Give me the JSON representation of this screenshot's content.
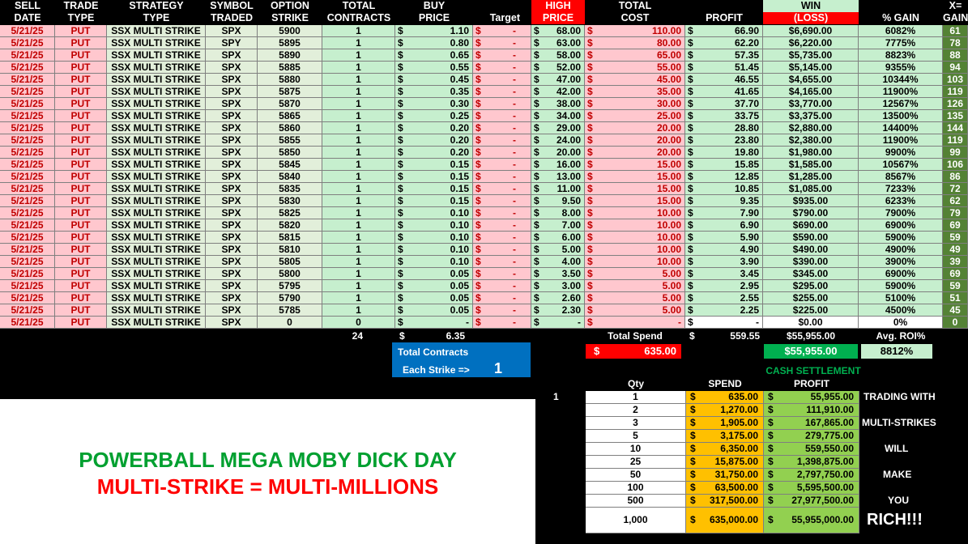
{
  "headers": {
    "sell_date": [
      "SELL",
      "DATE"
    ],
    "trade_type": [
      "TRADE",
      "TYPE"
    ],
    "strategy": [
      "STRATEGY",
      "TYPE"
    ],
    "symbol": [
      "SYMBOL",
      "TRADED"
    ],
    "option": [
      "OPTION",
      "STRIKE"
    ],
    "total_contracts": [
      "TOTAL",
      "CONTRACTS"
    ],
    "buy": [
      "BUY",
      "PRICE"
    ],
    "target": "Target",
    "high": [
      "HIGH",
      "PRICE"
    ],
    "total_cost": [
      "TOTAL",
      "COST"
    ],
    "profit": "PROFIT",
    "win": "WIN",
    "loss": "(LOSS)",
    "pct_gain": "% GAIN",
    "x_gain": [
      "X=",
      "GAIN"
    ]
  },
  "rows": [
    [
      "5/21/25",
      "PUT",
      "SSX MULTI STRIKE",
      "SPX",
      "5900",
      "1",
      "1.10",
      "-",
      "68.00",
      "110.00",
      "66.90",
      "$6,690.00",
      "6082%",
      "61"
    ],
    [
      "5/21/25",
      "PUT",
      "SSX MULTI STRIKE",
      "SPY",
      "5895",
      "1",
      "0.80",
      "-",
      "63.00",
      "80.00",
      "62.20",
      "$6,220.00",
      "7775%",
      "78"
    ],
    [
      "5/21/25",
      "PUT",
      "SSX MULTI STRIKE",
      "SPX",
      "5890",
      "1",
      "0.65",
      "-",
      "58.00",
      "65.00",
      "57.35",
      "$5,735.00",
      "8823%",
      "88"
    ],
    [
      "5/21/25",
      "PUT",
      "SSX MULTI STRIKE",
      "SPX",
      "5885",
      "1",
      "0.55",
      "-",
      "52.00",
      "55.00",
      "51.45",
      "$5,145.00",
      "9355%",
      "94"
    ],
    [
      "5/21/25",
      "PUT",
      "SSX MULTI STRIKE",
      "SPX",
      "5880",
      "1",
      "0.45",
      "-",
      "47.00",
      "45.00",
      "46.55",
      "$4,655.00",
      "10344%",
      "103"
    ],
    [
      "5/21/25",
      "PUT",
      "SSX MULTI STRIKE",
      "SPX",
      "5875",
      "1",
      "0.35",
      "-",
      "42.00",
      "35.00",
      "41.65",
      "$4,165.00",
      "11900%",
      "119"
    ],
    [
      "5/21/25",
      "PUT",
      "SSX MULTI STRIKE",
      "SPX",
      "5870",
      "1",
      "0.30",
      "-",
      "38.00",
      "30.00",
      "37.70",
      "$3,770.00",
      "12567%",
      "126"
    ],
    [
      "5/21/25",
      "PUT",
      "SSX MULTI STRIKE",
      "SPX",
      "5865",
      "1",
      "0.25",
      "-",
      "34.00",
      "25.00",
      "33.75",
      "$3,375.00",
      "13500%",
      "135"
    ],
    [
      "5/21/25",
      "PUT",
      "SSX MULTI STRIKE",
      "SPX",
      "5860",
      "1",
      "0.20",
      "-",
      "29.00",
      "20.00",
      "28.80",
      "$2,880.00",
      "14400%",
      "144"
    ],
    [
      "5/21/25",
      "PUT",
      "SSX MULTI STRIKE",
      "SPX",
      "5855",
      "1",
      "0.20",
      "-",
      "24.00",
      "20.00",
      "23.80",
      "$2,380.00",
      "11900%",
      "119"
    ],
    [
      "5/21/25",
      "PUT",
      "SSX MULTI STRIKE",
      "SPX",
      "5850",
      "1",
      "0.20",
      "-",
      "20.00",
      "20.00",
      "19.80",
      "$1,980.00",
      "9900%",
      "99"
    ],
    [
      "5/21/25",
      "PUT",
      "SSX MULTI STRIKE",
      "SPX",
      "5845",
      "1",
      "0.15",
      "-",
      "16.00",
      "15.00",
      "15.85",
      "$1,585.00",
      "10567%",
      "106"
    ],
    [
      "5/21/25",
      "PUT",
      "SSX MULTI STRIKE",
      "SPX",
      "5840",
      "1",
      "0.15",
      "-",
      "13.00",
      "15.00",
      "12.85",
      "$1,285.00",
      "8567%",
      "86"
    ],
    [
      "5/21/25",
      "PUT",
      "SSX MULTI STRIKE",
      "SPX",
      "5835",
      "1",
      "0.15",
      "-",
      "11.00",
      "15.00",
      "10.85",
      "$1,085.00",
      "7233%",
      "72"
    ],
    [
      "5/21/25",
      "PUT",
      "SSX MULTI STRIKE",
      "SPX",
      "5830",
      "1",
      "0.15",
      "-",
      "9.50",
      "15.00",
      "9.35",
      "$935.00",
      "6233%",
      "62"
    ],
    [
      "5/21/25",
      "PUT",
      "SSX MULTI STRIKE",
      "SPX",
      "5825",
      "1",
      "0.10",
      "-",
      "8.00",
      "10.00",
      "7.90",
      "$790.00",
      "7900%",
      "79"
    ],
    [
      "5/21/25",
      "PUT",
      "SSX MULTI STRIKE",
      "SPX",
      "5820",
      "1",
      "0.10",
      "-",
      "7.00",
      "10.00",
      "6.90",
      "$690.00",
      "6900%",
      "69"
    ],
    [
      "5/21/25",
      "PUT",
      "SSX MULTI STRIKE",
      "SPX",
      "5815",
      "1",
      "0.10",
      "-",
      "6.00",
      "10.00",
      "5.90",
      "$590.00",
      "5900%",
      "59"
    ],
    [
      "5/21/25",
      "PUT",
      "SSX MULTI STRIKE",
      "SPX",
      "5810",
      "1",
      "0.10",
      "-",
      "5.00",
      "10.00",
      "4.90",
      "$490.00",
      "4900%",
      "49"
    ],
    [
      "5/21/25",
      "PUT",
      "SSX MULTI STRIKE",
      "SPX",
      "5805",
      "1",
      "0.10",
      "-",
      "4.00",
      "10.00",
      "3.90",
      "$390.00",
      "3900%",
      "39"
    ],
    [
      "5/21/25",
      "PUT",
      "SSX MULTI STRIKE",
      "SPX",
      "5800",
      "1",
      "0.05",
      "-",
      "3.50",
      "5.00",
      "3.45",
      "$345.00",
      "6900%",
      "69"
    ],
    [
      "5/21/25",
      "PUT",
      "SSX MULTI STRIKE",
      "SPX",
      "5795",
      "1",
      "0.05",
      "-",
      "3.00",
      "5.00",
      "2.95",
      "$295.00",
      "5900%",
      "59"
    ],
    [
      "5/21/25",
      "PUT",
      "SSX MULTI STRIKE",
      "SPX",
      "5790",
      "1",
      "0.05",
      "-",
      "2.60",
      "5.00",
      "2.55",
      "$255.00",
      "5100%",
      "51"
    ],
    [
      "5/21/25",
      "PUT",
      "SSX MULTI STRIKE",
      "SPX",
      "5785",
      "1",
      "0.05",
      "-",
      "2.30",
      "5.00",
      "2.25",
      "$225.00",
      "4500%",
      "45"
    ],
    [
      "5/21/25",
      "PUT",
      "SSX MULTI STRIKE",
      "SPX",
      "0",
      "0",
      "-",
      "-",
      "-",
      "-",
      "-",
      "$0.00",
      "0%",
      "0"
    ]
  ],
  "totals": {
    "contracts": "24",
    "buy_dollar": "$",
    "buy": "6.35",
    "total_spend_label": "Total Spend",
    "spend_dollar": "$",
    "spend": "559.55",
    "win": "$55,955.00",
    "roi_label": "Avg. ROI%",
    "spend_box": "635.00",
    "spend_box_dollar": "$",
    "win_box": "$55,955.00",
    "roi": "8812%"
  },
  "contracts_box": {
    "title": "Total Contracts",
    "each": "Each Strike =>",
    "value": "1"
  },
  "banner": {
    "line1": "POWERBALL MEGA MOBY DICK DAY",
    "line2": "MULTI-STRIKE = MULTI-MILLIONS"
  },
  "cash": {
    "title": "CASH SETTLEMENT",
    "qty_label": "Qty",
    "spend_label": "SPEND",
    "profit_label": "PROFIT",
    "left_marker": "1",
    "rows": [
      [
        "1",
        "635.00",
        "55,955.00"
      ],
      [
        "2",
        "1,270.00",
        "111,910.00"
      ],
      [
        "3",
        "1,905.00",
        "167,865.00"
      ],
      [
        "5",
        "3,175.00",
        "279,775.00"
      ],
      [
        "10",
        "6,350.00",
        "559,550.00"
      ],
      [
        "25",
        "15,875.00",
        "1,398,875.00"
      ],
      [
        "50",
        "31,750.00",
        "2,797,750.00"
      ],
      [
        "100",
        "63,500.00",
        "5,595,500.00"
      ],
      [
        "500",
        "317,500.00",
        "27,977,500.00"
      ],
      [
        "1,000",
        "635,000.00",
        "55,955,000.00"
      ]
    ],
    "side": [
      "TRADING WITH",
      "MULTI-STRIKES",
      "WILL",
      "MAKE",
      "YOU",
      "RICH!!!"
    ]
  },
  "colors": {
    "pink": "#ffc7ce",
    "light_green": "#e2efda",
    "green": "#c6efce",
    "dark_green": "#548235",
    "orange": "#ffc000",
    "mid_green": "#92d050",
    "blue": "#0070c0",
    "red": "#ff0000"
  }
}
